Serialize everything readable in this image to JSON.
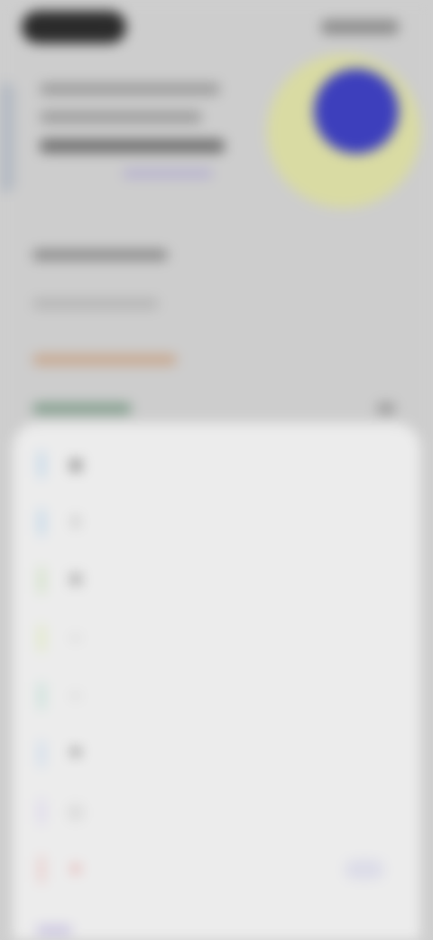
{
  "status_bar": {
    "pill_icon": "status-pill",
    "right_icons": "signal-wifi-battery"
  },
  "background_page": {
    "avatar_color": "#3d3fbc",
    "glow_color": "#d9dba3"
  },
  "menu": {
    "items": [
      {
        "icon": "grid-icon",
        "label": "",
        "accent": "#9fc6e8"
      },
      {
        "icon": "share-icon",
        "label": "",
        "accent": "#9fc6e8"
      },
      {
        "icon": "link-icon",
        "label": "",
        "accent": "#bcd9a6"
      },
      {
        "icon": "minus-icon",
        "label": "",
        "accent": "#d7e8a2"
      },
      {
        "icon": "minus-icon",
        "label": "",
        "accent": "#a9d7c9"
      },
      {
        "icon": "flag-icon",
        "label": "",
        "accent": "#b8d0ea"
      },
      {
        "icon": "info-icon",
        "label": "",
        "accent": "#d2c8ea"
      },
      {
        "icon": "trash-icon",
        "label": "",
        "accent": "#e7b3b0",
        "danger": true
      }
    ]
  },
  "colors": {
    "danger": "#d8504d",
    "sheet": "#ececec",
    "scrim": "#cdcdcd"
  }
}
